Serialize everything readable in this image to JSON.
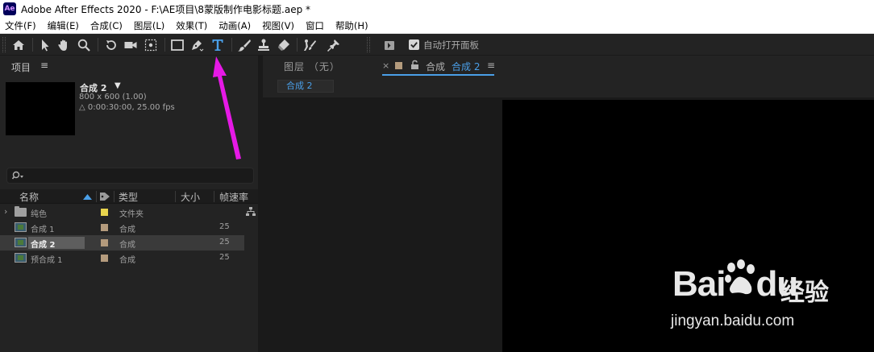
{
  "window": {
    "app_logo": "Ae",
    "title": "Adobe After Effects 2020 - F:\\AE项目\\8蒙版制作电影标题.aep *"
  },
  "menu": [
    "文件(F)",
    "编辑(E)",
    "合成(C)",
    "图层(L)",
    "效果(T)",
    "动画(A)",
    "视图(V)",
    "窗口",
    "帮助(H)"
  ],
  "toolbar": {
    "tools": [
      "home-icon",
      "selection-icon",
      "hand-icon",
      "zoom-icon",
      "rotate-icon",
      "camera-icon",
      "pan-behind-icon",
      "rectangle-icon",
      "pen-icon",
      "type-icon",
      "brush-icon",
      "clone-stamp-icon",
      "eraser-icon",
      "roto-brush-icon",
      "puppet-pin-icon",
      "workspace-icon"
    ],
    "active_tool": "type-icon",
    "auto_open_panel": {
      "checked": true,
      "label": "自动打开面板"
    }
  },
  "project_panel": {
    "tab_label": "项目",
    "menu_glyph": "≡",
    "selected_item": {
      "name": "合成 2",
      "caret": "▼",
      "size": "800 x 600 (1.00)",
      "duration": "△ 0:00:30:00, 25.00 fps"
    },
    "search": {
      "placeholder": "",
      "icon": "search-icon"
    },
    "columns": [
      "名称",
      "类型",
      "大小",
      "帧速率"
    ],
    "rows": [
      {
        "name": "纯色",
        "type": "文件夹",
        "fps": "",
        "icon": "folder-icon",
        "label_color": "#e8d44d",
        "selected": false,
        "expandable": true
      },
      {
        "name": "合成 1",
        "type": "合成",
        "fps": "25",
        "icon": "composition-icon",
        "label_color": "#b49b7d",
        "selected": false,
        "expandable": false
      },
      {
        "name": "合成 2",
        "type": "合成",
        "fps": "25",
        "icon": "composition-icon",
        "label_color": "#b49b7d",
        "selected": true,
        "expandable": false
      },
      {
        "name": "预合成 1",
        "type": "合成",
        "fps": "25",
        "icon": "composition-icon",
        "label_color": "#b49b7d",
        "selected": false,
        "expandable": false
      }
    ]
  },
  "comp_panel": {
    "layer_tab": "图层 （无）",
    "comp_tab_prefix": "合成",
    "comp_tab_name": "合成 2",
    "menu_glyph": "≡",
    "close_glyph": "×",
    "breadcrumb": "合成 2"
  },
  "watermark": {
    "brand": "Bai",
    "brand_suffix": "du",
    "text": "经验",
    "url": "jingyan.baidu.com"
  },
  "colors": {
    "accent": "#4a9fe8",
    "annotation": "#e619e6",
    "folder_label": "#e8d44d",
    "comp_label": "#b49b7d"
  }
}
